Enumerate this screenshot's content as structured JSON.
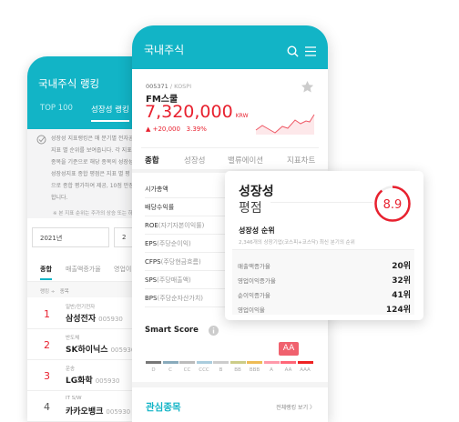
{
  "back": {
    "title": "국내주식 랭킹",
    "tabs": [
      "TOP 100",
      "성장성 랭킹"
    ],
    "desc": [
      "성장성 지표랭킹은 매 분기별 전자공시",
      "지표 별 순위를 보여줍니다. 각 지표",
      "종목을 기준으로 해당 종목의 성장성",
      "성장성지표 종합 평점은 지표 별 평",
      "으로 종합 평가하여 제공, 10점 만점",
      "합니다."
    ],
    "note": "※ 본 지표 순위는 주가의 상승 또는 하락",
    "year": "2021년",
    "quarter": "2",
    "subtabs": [
      "종합",
      "매출액증가율",
      "영업이"
    ],
    "col_rank": "랭킹 ÷",
    "col_item": "종목",
    "rows": [
      {
        "rank": "1",
        "industry": "일반/전기전자",
        "name": "삼성전자",
        "code": "005930"
      },
      {
        "rank": "2",
        "industry": "반도체",
        "name": "SK하이닉스",
        "code": "005930"
      },
      {
        "rank": "3",
        "industry": "운송",
        "name": "LG화학",
        "code": "005930"
      },
      {
        "rank": "4",
        "industry": "IT S/W",
        "name": "카카오뱅크",
        "code": "005930"
      }
    ]
  },
  "front": {
    "title": "국내주식",
    "code": "005371",
    "market": "/ KOSPI",
    "name": "FM스쿨",
    "price": "7,320,000",
    "currency": "KRW",
    "change": "▲ +20,000",
    "pct": "3.39%",
    "tabs": [
      "종합",
      "성장성",
      "밸류에이션",
      "지표차트"
    ],
    "metrics": [
      {
        "a": "시가총액",
        "b": ""
      },
      {
        "a": "배당수익률",
        "b": ""
      },
      {
        "a": "ROE",
        "b": "(자기자본이익률)"
      },
      {
        "a": "EPS",
        "b": "(주당순이익)"
      },
      {
        "a": "CFPS",
        "b": "(주당현금흐름)"
      },
      {
        "a": "SPS",
        "b": "(주당매출액)"
      },
      {
        "a": "BPS",
        "b": "(주당순자산가치)"
      }
    ],
    "smart_score": "Smart Score",
    "grades": [
      "D",
      "C",
      "CC",
      "CCC",
      "B",
      "BB",
      "BBB",
      "A",
      "AA",
      "AAA"
    ],
    "grade_colors": [
      "#777",
      "#8ab",
      "#bbb",
      "#acd",
      "#ccc",
      "#cc8",
      "#eb5",
      "#f9a",
      "#f67",
      "#e22"
    ],
    "current_grade": "AA",
    "watch_title": "관심종목",
    "watch_link": "전체랭킹 보기 〉"
  },
  "card": {
    "title1": "성장성",
    "title2": "평점",
    "score": "8.9",
    "score_fraction": 0.89,
    "rank_title": "성장성 순위",
    "rank_sub": "2,346개의 상장기업(코스피+코스닥) 최신 분기의 순위",
    "ranks": [
      {
        "label": "매출액증가율",
        "value": "20위"
      },
      {
        "label": "영업이익증가율",
        "value": "32위"
      },
      {
        "label": "순이익증가율",
        "value": "41위"
      },
      {
        "label": "영업이익율",
        "value": "124위"
      }
    ]
  }
}
